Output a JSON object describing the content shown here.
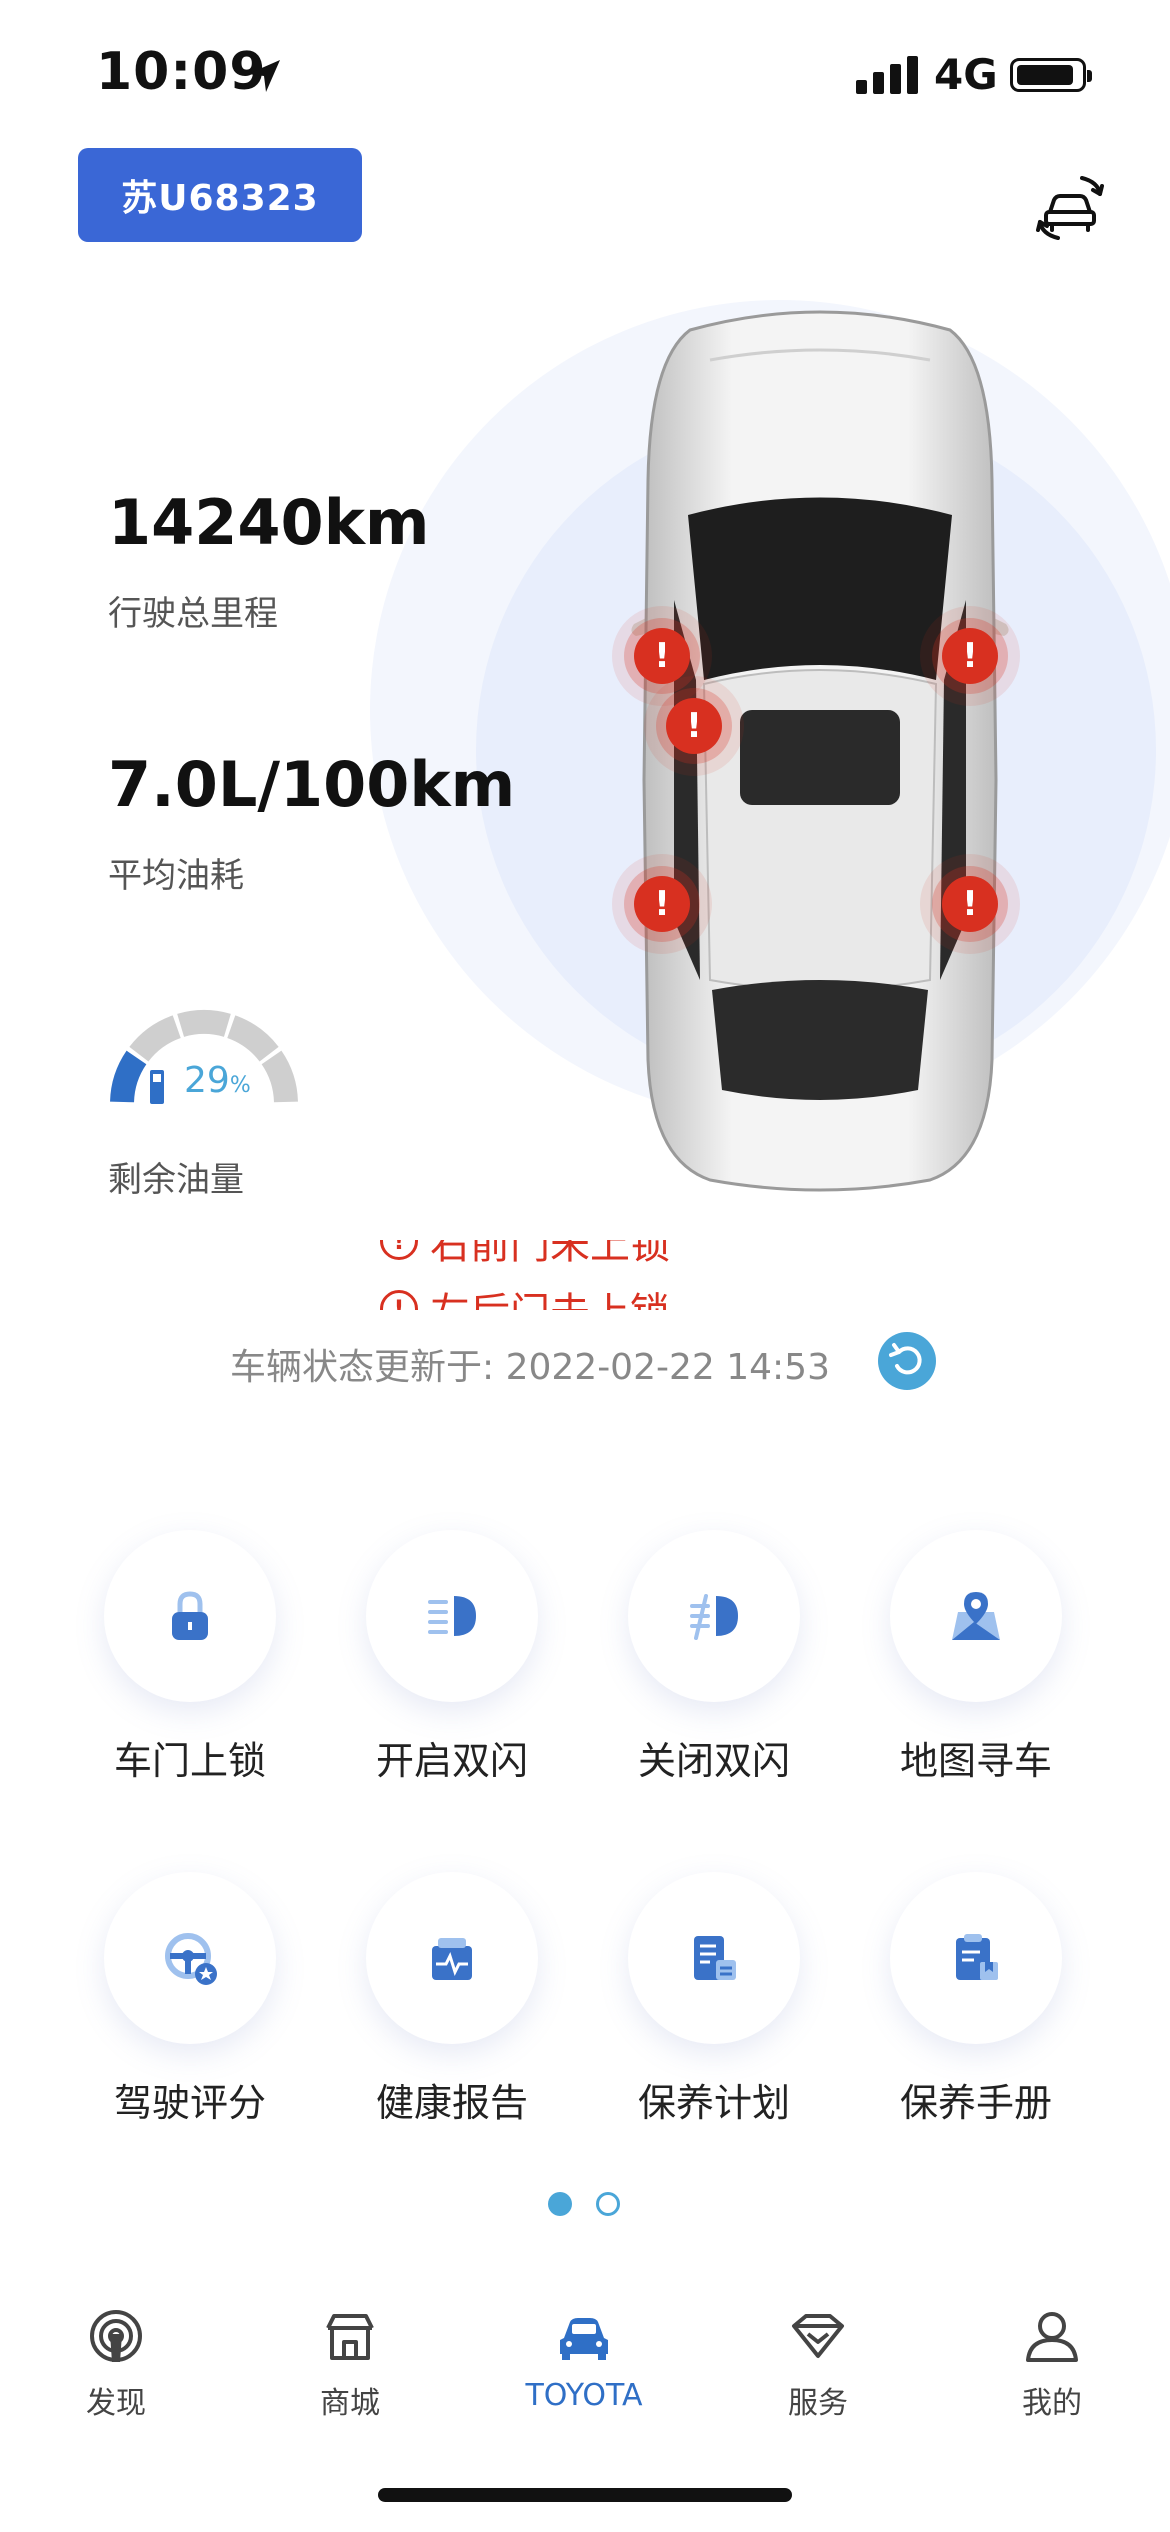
{
  "status_bar": {
    "time": "10:09",
    "network": "4G"
  },
  "plate": {
    "label": "苏U68323"
  },
  "stats": [
    {
      "value": "14240km",
      "label": "行驶总里程"
    },
    {
      "value": "7.0L/100km",
      "label": "平均油耗"
    }
  ],
  "fuel": {
    "percent": "29",
    "unit": "%",
    "label": "剩余油量",
    "level": 0.29
  },
  "warnings": [
    {
      "text": "右前门未上锁"
    },
    {
      "text": "左后门未上锁"
    }
  ],
  "update": {
    "text": "车辆状态更新于: 2022-02-22 14:53"
  },
  "actions": [
    {
      "label": "车门上锁",
      "icon": "lock-icon"
    },
    {
      "label": "开启双闪",
      "icon": "hazard-on-icon"
    },
    {
      "label": "关闭双闪",
      "icon": "hazard-off-icon"
    },
    {
      "label": "地图寻车",
      "icon": "map-pin-icon"
    },
    {
      "label": "驾驶评分",
      "icon": "steering-wheel-icon"
    },
    {
      "label": "健康报告",
      "icon": "health-report-icon"
    },
    {
      "label": "保养计划",
      "icon": "maintenance-plan-icon"
    },
    {
      "label": "保养手册",
      "icon": "maintenance-manual-icon"
    }
  ],
  "tabs": [
    {
      "label": "发现",
      "icon": "discover-icon"
    },
    {
      "label": "商城",
      "icon": "store-icon"
    },
    {
      "label": "TOYOTA",
      "icon": "car-icon"
    },
    {
      "label": "服务",
      "icon": "diamond-icon"
    },
    {
      "label": "我的",
      "icon": "user-icon"
    }
  ],
  "colors": {
    "accent": "#3a67d6",
    "warning": "#d83020",
    "tab_active": "#2f6fc6",
    "refresh": "#4aa6d8"
  }
}
